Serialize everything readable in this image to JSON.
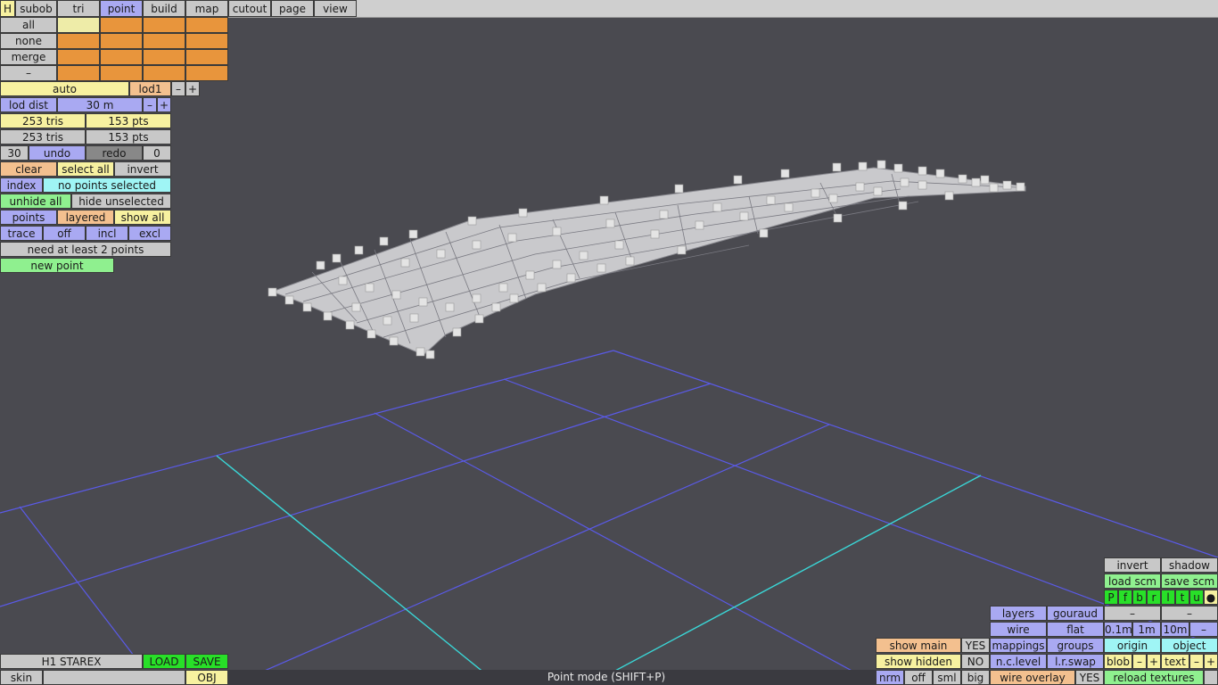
{
  "menu": [
    "H",
    "subob",
    "tri",
    "point",
    "build",
    "map",
    "cutout",
    "page",
    "view"
  ],
  "selection": {
    "all": "all",
    "none": "none",
    "merge": "merge",
    "dash": "–"
  },
  "lod": {
    "auto": "auto",
    "lod1": "lod1",
    "minus": "–",
    "plus": "+",
    "dist_label": "lod dist",
    "dist_value": "30 m"
  },
  "stats": {
    "tris1": "253 tris",
    "pts1": "153 pts",
    "tris2": "253 tris",
    "pts2": "153 pts"
  },
  "undo": {
    "count": "30",
    "undo": "undo",
    "redo": "redo",
    "redo_count": "0"
  },
  "pointops": {
    "clear": "clear",
    "select_all": "select all",
    "invert": "invert",
    "index": "index",
    "selection_status": "no points selected",
    "unhide_all": "unhide all",
    "hide_unselected": "hide unselected",
    "points": "points",
    "layered": "layered",
    "show_all": "show all",
    "trace": "trace",
    "off": "off",
    "incl": "incl",
    "excl": "excl",
    "need": "need at least 2 points",
    "new_point": "new point"
  },
  "file": {
    "name": "H1 STAREX",
    "load": "LOAD",
    "save": "SAVE",
    "skin": "skin",
    "obj": "OBJ"
  },
  "status": "Point mode (SHIFT+P)",
  "right": {
    "invert": "invert",
    "shadow": "shadow",
    "load_scm": "load scm",
    "save_scm": "save scm",
    "views": [
      "P",
      "f",
      "b",
      "r",
      "l",
      "t",
      "u",
      "●"
    ],
    "layers": "layers",
    "gouraud": "gouraud",
    "wire": "wire",
    "flat": "flat",
    "dash1": "–",
    "dash2": "–",
    "g01": "0.1m",
    "g1": "1m",
    "g10": "10m",
    "gdash": "–",
    "mappings": "mappings",
    "groups": "groups",
    "origin": "origin",
    "object": "object",
    "ncl": "n.c.level",
    "lrswap": "l.r.swap",
    "blob": "blob",
    "text": "text",
    "minus": "–",
    "plus": "+",
    "wire_overlay": "wire overlay",
    "yes": "YES",
    "reload": "reload textures",
    "show_main": "show main",
    "show_main_val": "YES",
    "show_hidden": "show hidden",
    "show_hidden_val": "NO",
    "nrm": "nrm",
    "off": "off",
    "sml": "sml",
    "big": "big"
  }
}
